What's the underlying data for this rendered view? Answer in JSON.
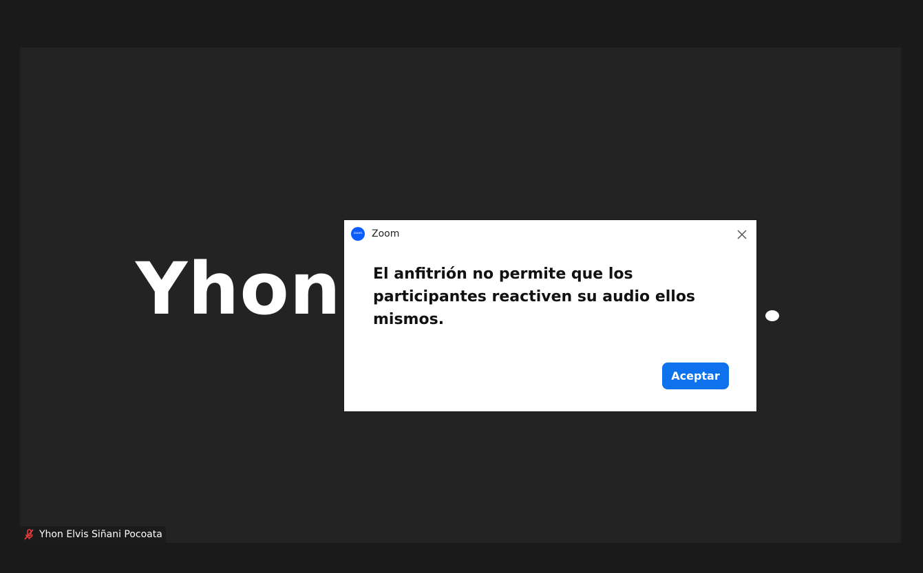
{
  "video": {
    "participant_display_name": "Yhon"
  },
  "participant": {
    "name": "Yhon Elvis Siñani Pocoata",
    "mic_state_icon": "mic-muted-icon"
  },
  "dialog": {
    "app_name": "Zoom",
    "app_icon_text": "zoom",
    "message": "El anfitrión no permite que los participantes reactiven su audio ellos mismos.",
    "accept_label": "Aceptar",
    "close_icon": "close-icon"
  },
  "colors": {
    "background": "#1a1a1a",
    "video_tile": "#232323",
    "accent_button": "#0e72ed",
    "zoom_brand": "#0b5cff",
    "muted_mic": "#e03e3e"
  }
}
